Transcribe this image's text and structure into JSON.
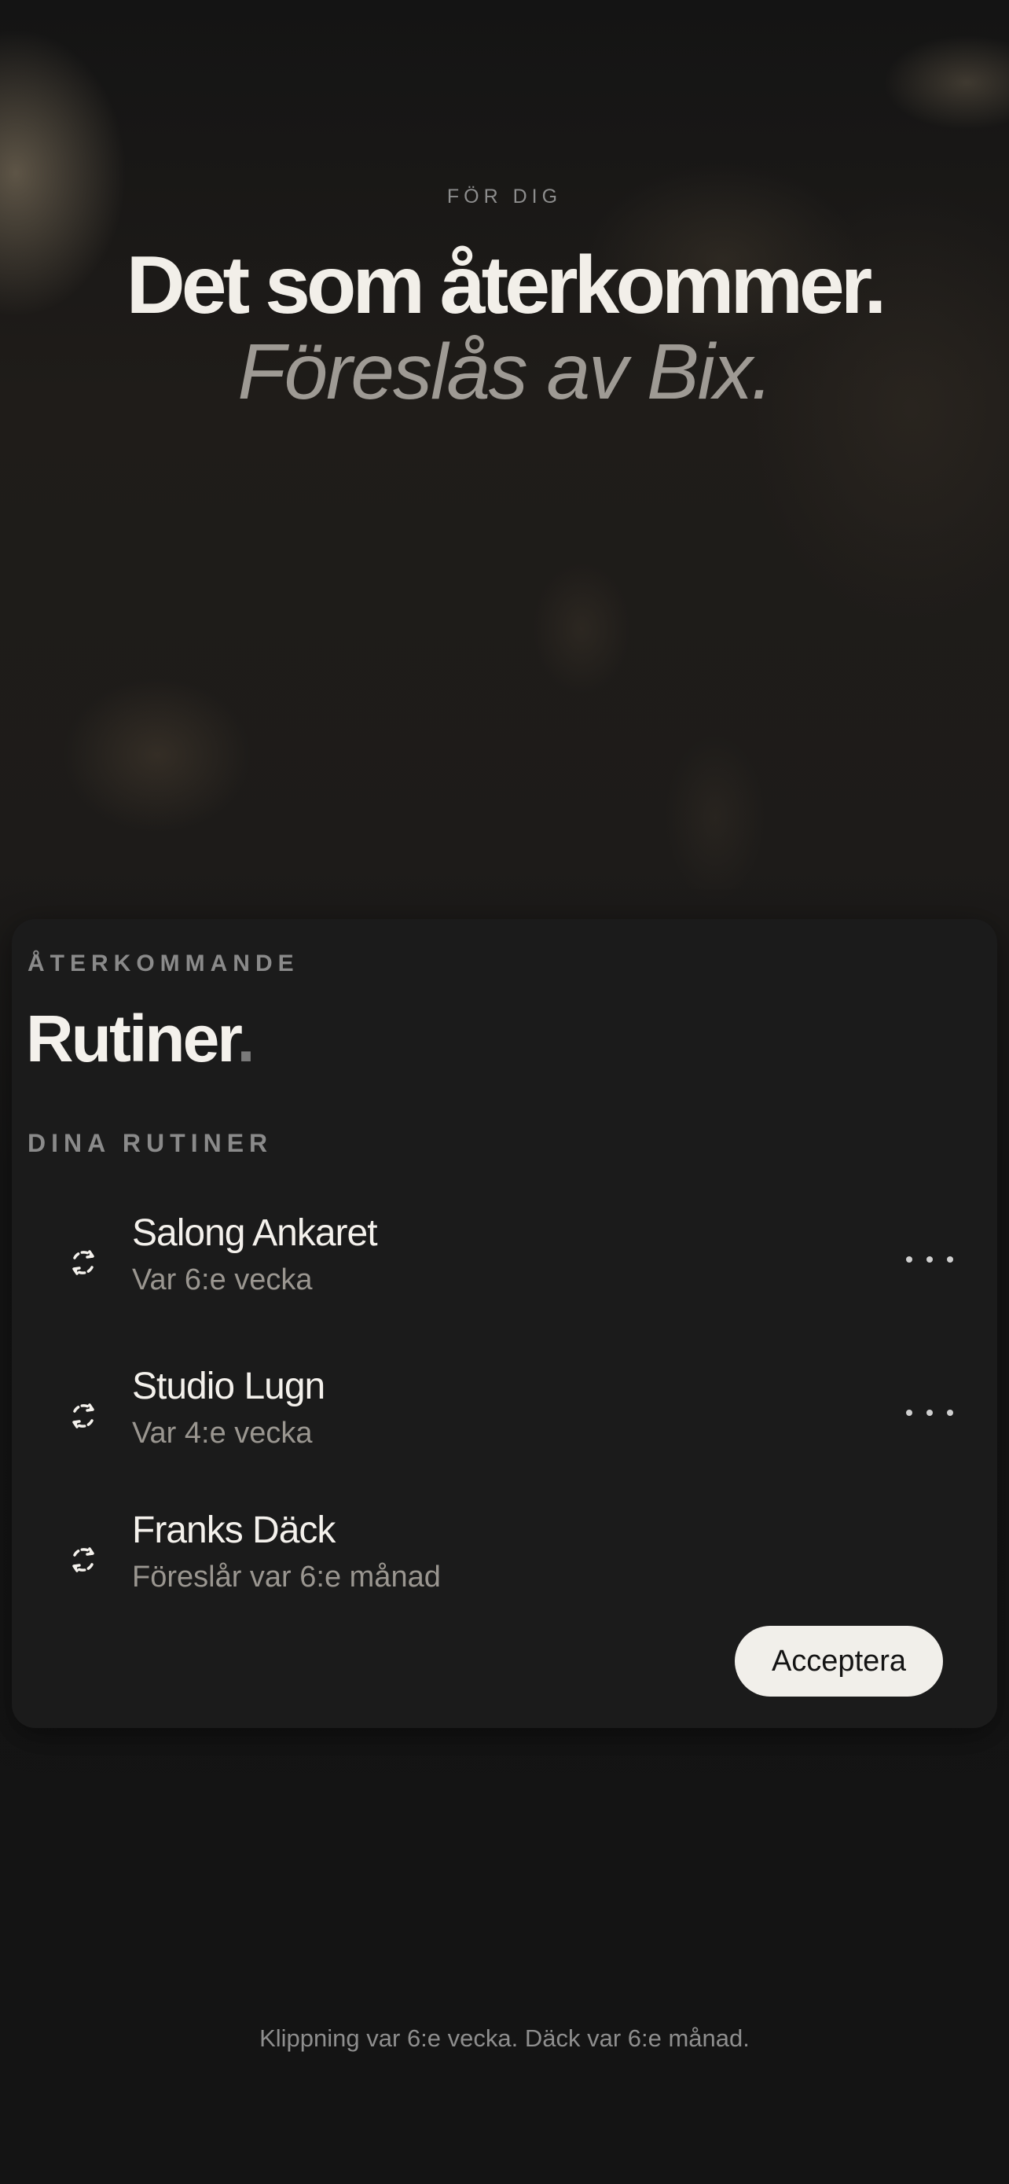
{
  "header": {
    "eyebrow": "FÖR DIG",
    "headline": "Det som återkommer.",
    "subhead": "Föreslås av Bix."
  },
  "card": {
    "eyebrow": "ÅTERKOMMANDE",
    "title": "Rutiner",
    "title_dot": ".",
    "section_label": "DINA RUTINER",
    "routines": [
      {
        "title": "Salong Ankaret",
        "subtitle": "Var 6:e vecka",
        "icon": "repeat-icon",
        "has_more": true
      },
      {
        "title": "Studio Lugn",
        "subtitle": "Var 4:e vecka",
        "icon": "repeat-icon",
        "has_more": true
      },
      {
        "title": "Franks Däck",
        "subtitle": "Föreslår var 6:e månad",
        "icon": "repeat-icon",
        "has_more": false
      }
    ],
    "accept_label": "Acceptera"
  },
  "footer": {
    "text": "Klippning var 6:e vecka. Däck var 6:e månad."
  },
  "colors": {
    "background": "#141414",
    "card": "#1b1b1b",
    "text_primary": "#f4f1ec",
    "text_secondary": "#9a9690",
    "button_bg": "#f1efea"
  }
}
